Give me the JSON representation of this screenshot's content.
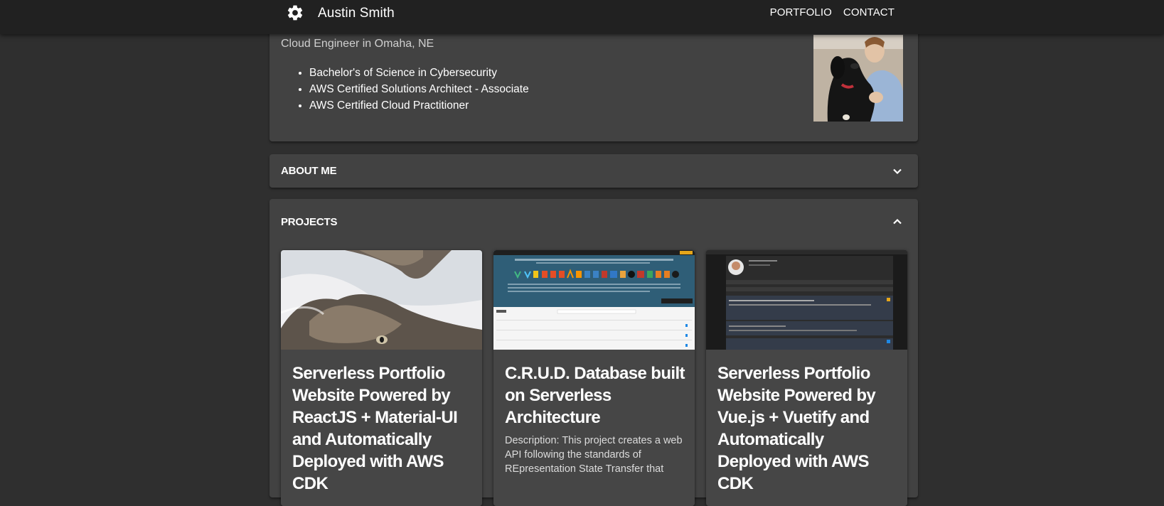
{
  "header": {
    "title": "Austin Smith",
    "nav": [
      "PORTFOLIO",
      "CONTACT"
    ]
  },
  "profile": {
    "subtitle": "Cloud Engineer in Omaha, NE",
    "credentials": [
      "Bachelor's of Science in Cybersecurity",
      "AWS Certified Solutions Architect - Associate",
      "AWS Certified Cloud Practitioner"
    ]
  },
  "sections": {
    "about": "ABOUT ME",
    "projects": "PROJECTS"
  },
  "projects": [
    {
      "title": "Serverless Portfolio Website Powered by ReactJS + Material-UI and Automatically Deployed with AWS CDK",
      "description": ""
    },
    {
      "title": "C.R.U.D. Database built on Serverless Architecture",
      "description": "Description: This project creates a web API following the standards of REpresentation State Transfer that"
    },
    {
      "title": "Serverless Portfolio Website Powered by Vue.js + Vuetify and Automatically Deployed with AWS CDK",
      "description": ""
    }
  ],
  "icons": {
    "logo": "gear-icon",
    "about_toggle": "chevron-down-icon",
    "projects_toggle": "chevron-up-icon"
  },
  "colors": {
    "background": "#2f2f2f",
    "appbar": "#212121",
    "card": "#424242",
    "text": "#ffffff"
  }
}
